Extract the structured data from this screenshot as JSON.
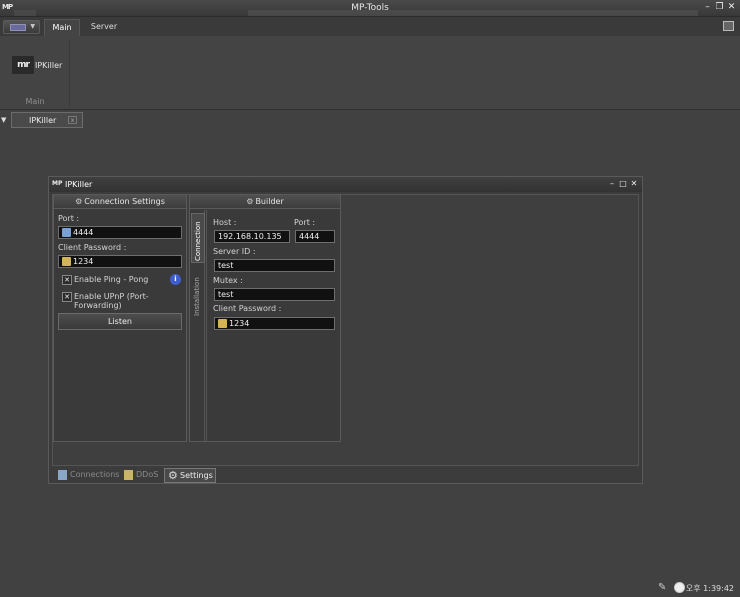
{
  "window": {
    "title": "MP-Tools"
  },
  "ribbon": {
    "tabs": [
      {
        "label": "Main"
      },
      {
        "label": "Server"
      }
    ],
    "buttons": [
      {
        "label": "IPKiller",
        "logo": "mr"
      }
    ],
    "group_label": "Main"
  },
  "doc_tabs": [
    {
      "label": "IPKiller"
    }
  ],
  "child_window": {
    "title": "IPKiller",
    "connection_panel": {
      "header": "Connection Settings",
      "port_label": "Port :",
      "port_value": "4444",
      "password_label": "Client Password :",
      "password_value": "1234",
      "enable_ping": {
        "label": "Enable Ping - Pong",
        "checked": true
      },
      "enable_upnp": {
        "label": "Enable UPnP (Port-Forwarding)",
        "checked": true
      },
      "listen_button": "Listen"
    },
    "builder_panel": {
      "header": "Builder",
      "vtabs": [
        {
          "label": "Connection",
          "active": true
        },
        {
          "label": "Installation",
          "active": false
        }
      ],
      "host_label": "Host :",
      "host_value": "192.168.10.135",
      "port_label": "Port :",
      "port_value": "4444",
      "server_id_label": "Server ID :",
      "server_id_value": "test",
      "mutex_label": "Mutex :",
      "mutex_value": "test",
      "password_label": "Client Password :",
      "password_value": "1234"
    },
    "bottom_tabs": [
      {
        "label": "Connections",
        "active": false
      },
      {
        "label": "DDoS",
        "active": false
      },
      {
        "label": "Settings",
        "active": true
      }
    ]
  },
  "status": {
    "time": "오후 1:39:42"
  },
  "colors": {
    "background": "#414141",
    "accent": "#3e5ecf"
  }
}
